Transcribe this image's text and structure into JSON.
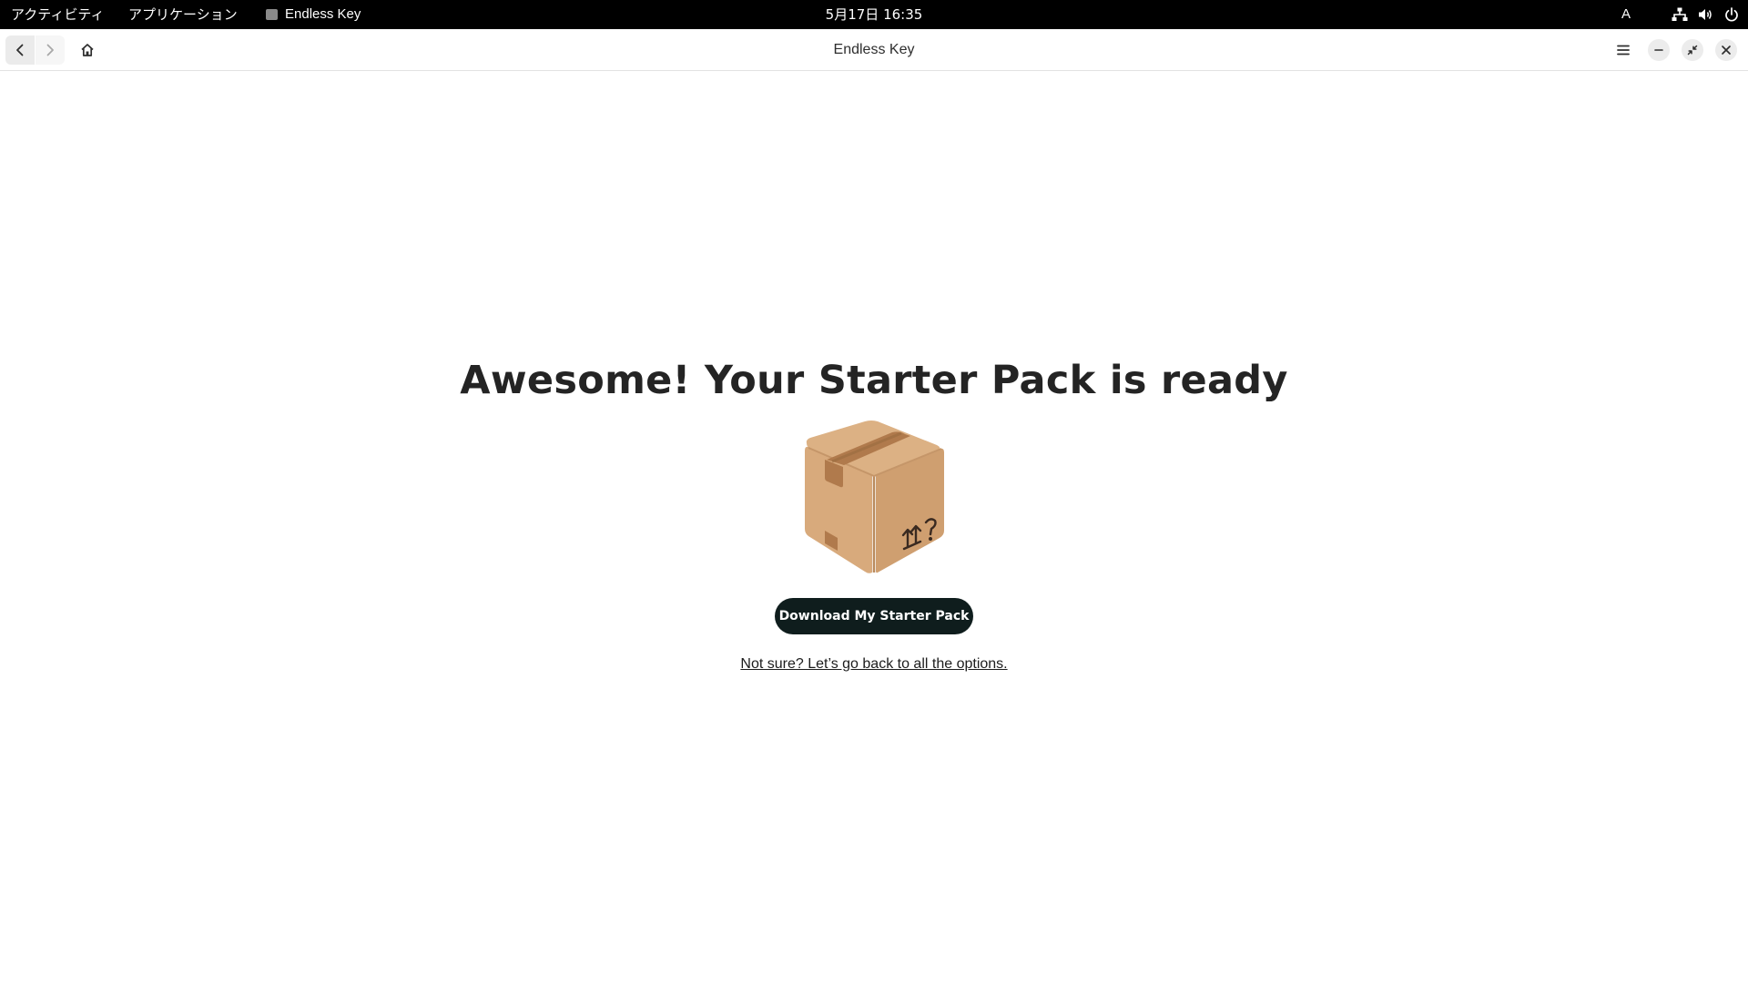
{
  "topbar": {
    "activities_label": "アクティビティ",
    "applications_label": "アプリケーション",
    "window_app_label": "Endless Key",
    "clock": "5月17日  16:35",
    "input_method": "A",
    "icons": [
      "network-icon",
      "volume-icon",
      "power-icon"
    ]
  },
  "headerbar": {
    "title": "Endless Key",
    "icons": [
      "back-icon",
      "forward-icon",
      "home-icon",
      "menu-icon",
      "minimize-icon",
      "restore-icon",
      "close-icon"
    ]
  },
  "main": {
    "headline": "Awesome! Your Starter Pack is ready",
    "illustration": "cardboard-box-icon",
    "download_button_label": "Download My Starter Pack",
    "back_link_text": "Not sure? Let’s go back to all the options."
  },
  "colors": {
    "topbar_bg": "#000000",
    "button_bg": "#0f1d1d",
    "box_light": "#d9ae80",
    "box_dark": "#c99a6c",
    "tape": "#a9744a"
  }
}
